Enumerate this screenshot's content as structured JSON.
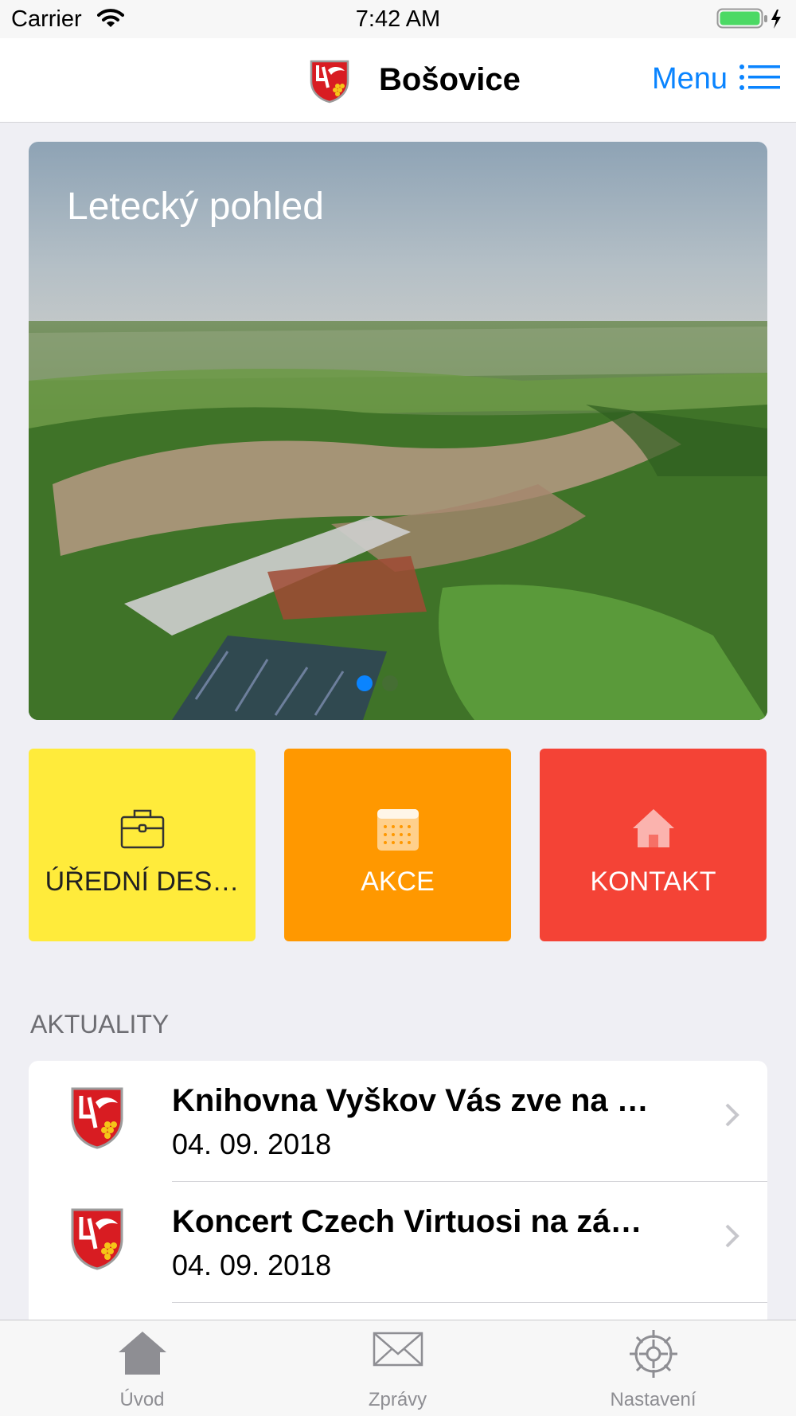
{
  "status_bar": {
    "carrier": "Carrier",
    "time": "7:42 AM"
  },
  "nav": {
    "title": "Bošovice",
    "menu_label": "Menu"
  },
  "hero": {
    "title": "Letecký pohled",
    "page_count": 2,
    "current_page": 1
  },
  "tiles": [
    {
      "label": "ÚŘEDNÍ DES…",
      "icon": "briefcase-icon",
      "color": "#ffeb3b",
      "text_color": "#212121"
    },
    {
      "label": "AKCE",
      "icon": "calendar-icon",
      "color": "#ff9800",
      "text_color": "#ffffff"
    },
    {
      "label": "KONTAKT",
      "icon": "home-icon",
      "color": "#f44336",
      "text_color": "#ffffff"
    }
  ],
  "news": {
    "header": "AKTUALITY",
    "items": [
      {
        "title": "Knihovna Vyškov Vás zve na výs…",
        "date": "04. 09. 2018"
      },
      {
        "title": "Koncert Czech Virtuosi na zámk…",
        "date": "04. 09. 2018"
      }
    ]
  },
  "tab_bar": {
    "tabs": [
      {
        "label": "Úvod",
        "icon": "home-icon",
        "selected": true
      },
      {
        "label": "Zprávy",
        "icon": "envelope-icon",
        "selected": false
      },
      {
        "label": "Nastavení",
        "icon": "gear-icon",
        "selected": false
      }
    ]
  },
  "colors": {
    "accent": "#0a84ff",
    "background": "#efeff4",
    "tab_inactive": "#8e8e93"
  }
}
